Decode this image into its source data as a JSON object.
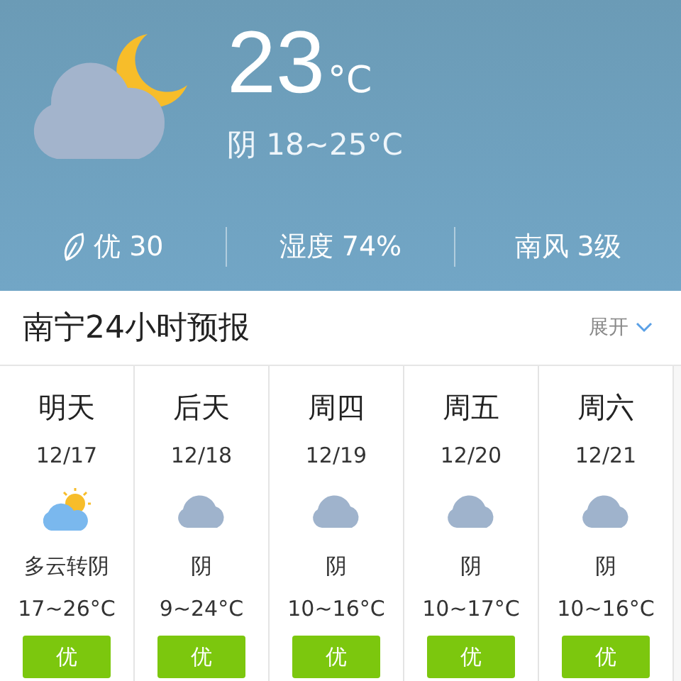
{
  "current": {
    "temperature": "23",
    "unit": "°C",
    "condition": "阴 18~25°C"
  },
  "stats": [
    {
      "kind": "aqi",
      "text": "优 30"
    },
    {
      "kind": "plain",
      "text": "湿度 74%"
    },
    {
      "kind": "plain",
      "text": "南风 3级"
    }
  ],
  "forecast": {
    "title": "南宁24小时预报",
    "toggle": "展开",
    "days": [
      {
        "day": "明天",
        "date": "12/17",
        "kind": "partly_cloudy",
        "condition": "多云转阴",
        "temps": "17~26°C",
        "aqi": "优"
      },
      {
        "day": "后天",
        "date": "12/18",
        "kind": "overcast",
        "condition": "阴",
        "temps": "9~24°C",
        "aqi": "优"
      },
      {
        "day": "周四",
        "date": "12/19",
        "kind": "overcast",
        "condition": "阴",
        "temps": "10~16°C",
        "aqi": "优"
      },
      {
        "day": "周五",
        "date": "12/20",
        "kind": "overcast",
        "condition": "阴",
        "temps": "10~17°C",
        "aqi": "优"
      },
      {
        "day": "周六",
        "date": "12/21",
        "kind": "overcast",
        "condition": "阴",
        "temps": "10~16°C",
        "aqi": "优"
      }
    ]
  }
}
